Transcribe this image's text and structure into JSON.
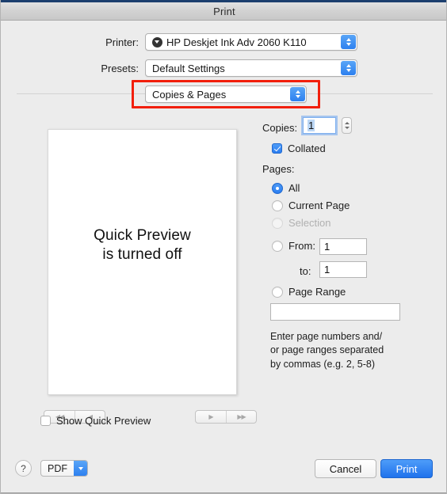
{
  "window": {
    "title": "Print"
  },
  "form": {
    "printer_label": "Printer:",
    "printer_value": "HP Deskjet Ink Adv 2060 K110",
    "printer_icon": "printer-status-icon",
    "presets_label": "Presets:",
    "presets_value": "Default Settings",
    "pane_value": "Copies & Pages"
  },
  "annotation": {
    "color": "#f21f0c",
    "target": "copies-and-pages-popup"
  },
  "preview": {
    "line1": "Quick Preview",
    "line2": "is turned off",
    "nav": {
      "first": "◀◀",
      "prev": "◀",
      "next": "▶",
      "last": "▶▶"
    },
    "show_quick_preview_label": "Show Quick Preview",
    "show_quick_preview_checked": false
  },
  "options": {
    "copies_label": "Copies:",
    "copies_value": "1",
    "collated_label": "Collated",
    "collated_checked": true,
    "pages_label": "Pages:",
    "radios": [
      {
        "label": "All",
        "selected": true,
        "disabled": false
      },
      {
        "label": "Current Page",
        "selected": false,
        "disabled": false
      },
      {
        "label": "Selection",
        "selected": false,
        "disabled": true
      },
      {
        "label": "From:",
        "selected": false,
        "disabled": false
      },
      {
        "label": "Page Range",
        "selected": false,
        "disabled": false
      }
    ],
    "from_value": "1",
    "to_label": "to:",
    "to_value": "1",
    "page_range_value": "",
    "help_line1": "Enter page numbers and/",
    "help_line2": "or page ranges separated",
    "help_line3": "by commas (e.g. 2, 5-8)"
  },
  "footer": {
    "help_label": "?",
    "pdf_label": "PDF",
    "cancel_label": "Cancel",
    "print_label": "Print"
  },
  "colors": {
    "accent": "#2d80ef",
    "annotation": "#f21f0c",
    "window_bg": "#ececec"
  }
}
